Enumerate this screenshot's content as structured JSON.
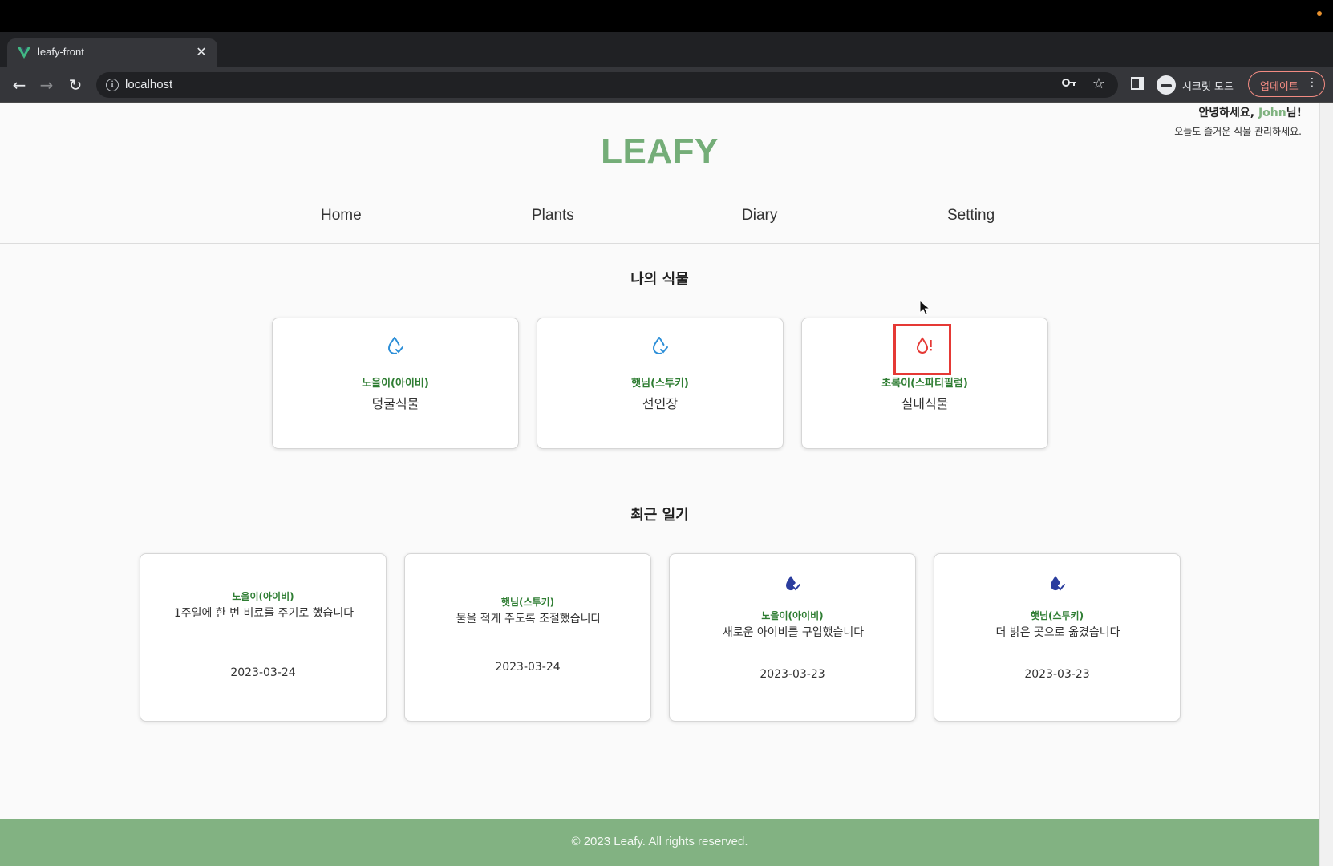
{
  "browser": {
    "tab_title": "leafy-front",
    "close_glyph": "✕",
    "new_tab_glyph": "+",
    "tab_list_glyph": "⌄",
    "url": "localhost",
    "incognito_label": "시크릿 모드",
    "update_label": "업데이트",
    "more_glyph": "⋮",
    "back_glyph": "←",
    "forward_glyph": "→",
    "reload_glyph": "↻",
    "info_glyph": "i",
    "key_glyph": "🔑",
    "star_glyph": "☆",
    "favicon": "vue-logo-icon"
  },
  "header": {
    "greeting_prefix": "안녕하세요, ",
    "user_name": "John",
    "greeting_suffix": "님!",
    "subtitle": "오늘도 즐거운 식물 관리하세요.",
    "logo": "LEAFY"
  },
  "nav": {
    "items": [
      "Home",
      "Plants",
      "Diary",
      "Setting"
    ]
  },
  "plants_section": {
    "title": "나의 식물",
    "cards": [
      {
        "nickname": "노을이(아이비)",
        "species": "덩굴식물",
        "status": "watered",
        "icon": "water-drop-check-icon"
      },
      {
        "nickname": "햇님(스투키)",
        "species": "선인장",
        "status": "watered",
        "icon": "water-drop-check-icon"
      },
      {
        "nickname": "초록이(스파티필럼)",
        "species": "실내식물",
        "status": "needs-water",
        "icon": "water-drop-alert-icon"
      }
    ]
  },
  "diary_section": {
    "title": "최근 일기",
    "cards": [
      {
        "nickname": "노을이(아이비)",
        "content": "1주일에 한 번 비료를 주기로 했습니다",
        "date": "2023-03-24",
        "has_icon": false
      },
      {
        "nickname": "햇님(스투키)",
        "content": "물을 적게 주도록 조절했습니다",
        "date": "2023-03-24",
        "has_icon": false
      },
      {
        "nickname": "노을이(아이비)",
        "content": "새로운 아이비를 구입했습니다",
        "date": "2023-03-23",
        "has_icon": true,
        "icon": "water-drop-filled-icon"
      },
      {
        "nickname": "햇님(스투키)",
        "content": "더 밝은 곳으로 옮겼습니다",
        "date": "2023-03-23",
        "has_icon": true,
        "icon": "water-drop-filled-icon"
      }
    ]
  },
  "footer": {
    "text": "© 2023 Leafy. All rights reserved."
  },
  "colors": {
    "brand": "#74ad78",
    "footer": "#82b282",
    "nickname": "#2e7d32",
    "water_ok": "#2d8fd8",
    "water_alert": "#e53935",
    "diary_drop": "#2b3d9e"
  }
}
